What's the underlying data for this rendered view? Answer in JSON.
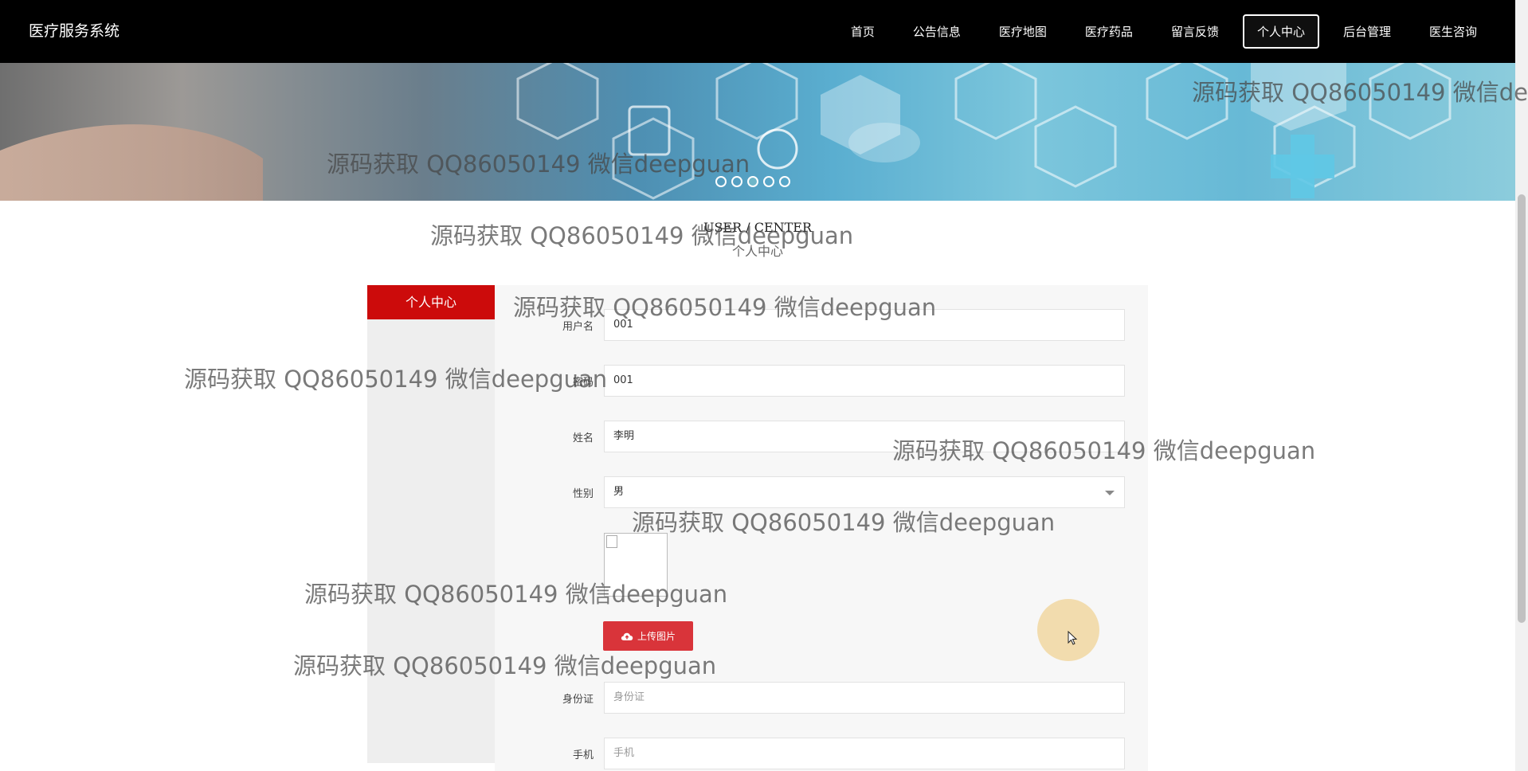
{
  "brand": "医疗服务系统",
  "nav": [
    "首页",
    "公告信息",
    "医疗地图",
    "医疗药品",
    "留言反馈",
    "个人中心",
    "后台管理",
    "医生咨询"
  ],
  "nav_active": "个人中心",
  "section": {
    "title_en": "USER / CENTER",
    "title_zh": "个人中心"
  },
  "sidebar": {
    "active": "个人中心"
  },
  "form": {
    "username": {
      "label": "用户名",
      "value": "001"
    },
    "password": {
      "label": "密码",
      "value": "001"
    },
    "name": {
      "label": "姓名",
      "value": "李明"
    },
    "gender": {
      "label": "性别",
      "value": "男"
    },
    "upload_button": "上传图片",
    "id_card": {
      "label": "身份证",
      "placeholder": "身份证"
    },
    "phone": {
      "label": "手机",
      "placeholder": "手机"
    }
  },
  "watermark": "源码获取 QQ86050149 微信deepguan",
  "colors": {
    "topbar": "#000000",
    "accent_red": "#cc0b0b",
    "upload_red": "#d9343a",
    "sidebar_bg": "#eeeeee",
    "panel_bg": "#f7f7f7"
  },
  "icons": {
    "upload": "cloud-upload-icon",
    "select": "chevron-down-icon",
    "cursor": "mouse-pointer-icon"
  }
}
